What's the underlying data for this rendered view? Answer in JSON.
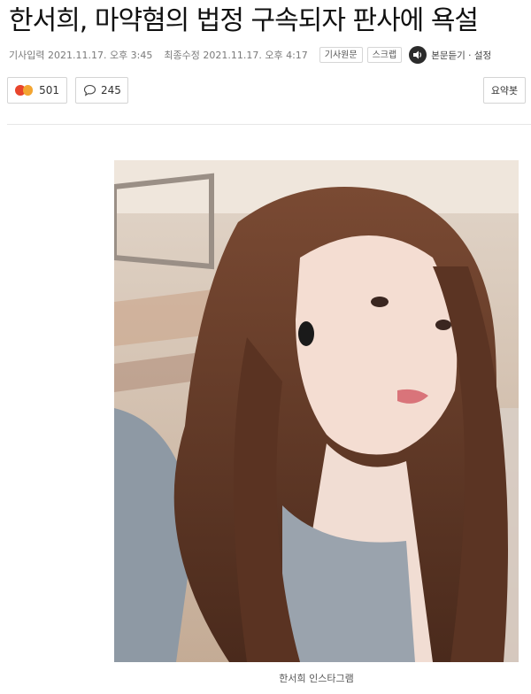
{
  "article": {
    "headline": "한서희, 마약혐의 법정 구속되자 판사에 욕설",
    "published_label": "기사입력 2021.11.17. 오후 3:45",
    "modified_label": "최종수정 2021.11.17. 오후 4:17",
    "original_button": "기사원문",
    "scrap_button": "스크랩",
    "listen_label": "본문듣기 · 설정"
  },
  "reactions": {
    "emotion_count": "501",
    "comment_count": "245",
    "summary_button": "요약봇"
  },
  "photo": {
    "caption": "한서희 인스타그램"
  },
  "colors": {
    "angry_emoji": "#e8452c",
    "sad_emoji": "#f3a531"
  }
}
